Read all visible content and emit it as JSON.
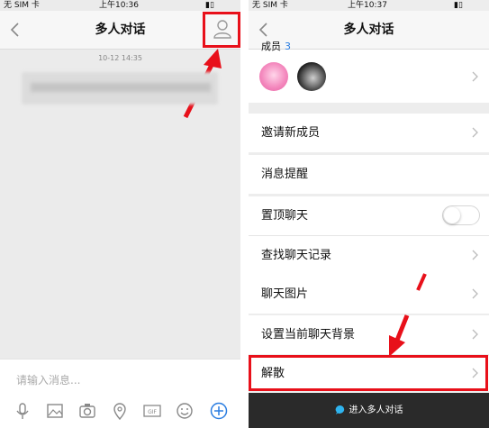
{
  "left": {
    "status": {
      "carrier": "无 SIM 卡",
      "time": "上午10:36"
    },
    "nav_title": "多人对话",
    "timestamp": "10-12 14:35",
    "input_placeholder": "请输入消息...",
    "toolbar_icons": [
      "mic-icon",
      "image-icon",
      "camera-icon",
      "location-icon",
      "gif-icon",
      "emoji-icon",
      "plus-icon"
    ]
  },
  "right": {
    "status": {
      "carrier": "无 SIM 卡",
      "time": "上午10:37"
    },
    "nav_title": "多人对话",
    "members_label": "成员",
    "members_count": "3",
    "rows": {
      "invite": "邀请新成员",
      "notify": "消息提醒",
      "pin": "置顶聊天",
      "search": "查找聊天记录",
      "images": "聊天图片",
      "background": "设置当前聊天背景",
      "dissolve": "解散"
    },
    "bottom_button": "进入多人对话"
  },
  "colors": {
    "highlight": "#e8101a",
    "accent": "#2a7de1",
    "bottom_bar": "#2a2a2a"
  }
}
